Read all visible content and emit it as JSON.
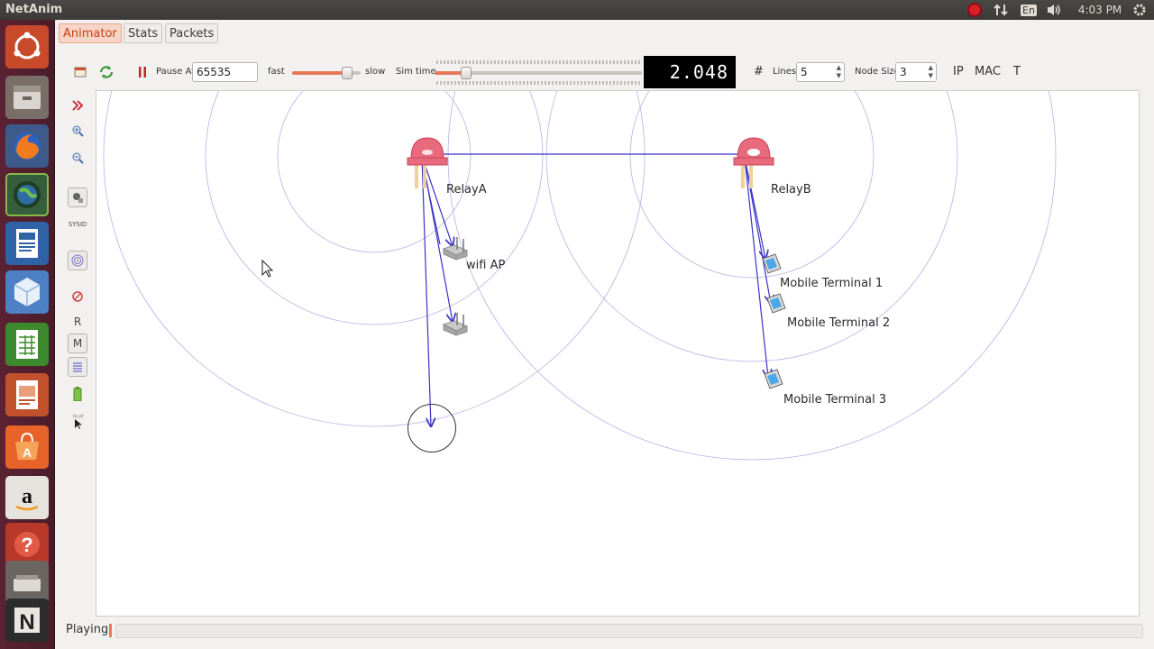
{
  "topbar": {
    "app_title": "NetAnim",
    "keyboard_layout": "En",
    "clock": "4:03 PM"
  },
  "tabs": [
    {
      "label": "Animator",
      "active": true
    },
    {
      "label": "Stats",
      "active": false
    },
    {
      "label": "Packets",
      "active": false
    }
  ],
  "toolbar": {
    "pause_at_label": "Pause At",
    "pause_at_value": "65535",
    "speed_fast_label": "fast",
    "speed_slow_label": "slow",
    "speed_level": 0.8,
    "sim_time_label": "Sim time",
    "sim_time_level": 0.15,
    "sim_time_value": "2.048",
    "grid_symbol": "#",
    "lines_label": "Lines",
    "lines_value": "5",
    "node_size_label": "Node Size",
    "node_size_value": "3",
    "ip_label": "IP",
    "mac_label": "MAC",
    "t_label": "T"
  },
  "sidebar": {
    "r_label": "R",
    "m_label": "M"
  },
  "nodes": {
    "relay_a": "RelayA",
    "relay_b": "RelayB",
    "wifi_ap": "wifi AP",
    "mobile_1": "Mobile Terminal 1",
    "mobile_2": "Mobile Terminal 2",
    "mobile_3": "Mobile Terminal 3"
  },
  "status": {
    "text": "Playing"
  },
  "colors": {
    "accent": "#e9785a",
    "link": "#3a33c9",
    "range_circle": "#b4b2e6",
    "launcher_bg": "#5b2233"
  }
}
